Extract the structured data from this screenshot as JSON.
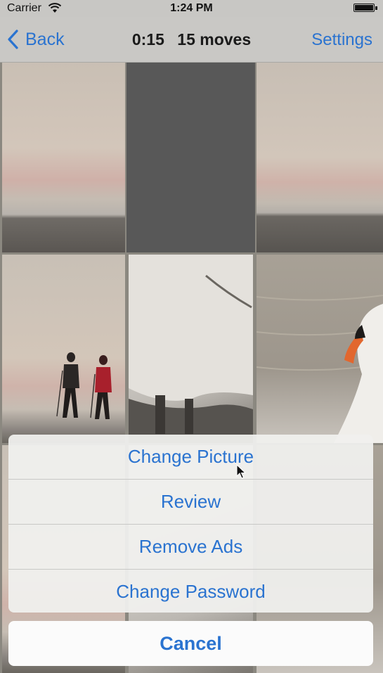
{
  "status_bar": {
    "carrier": "Carrier",
    "time": "1:24 PM",
    "wifi_icon": "wifi-icon",
    "battery_icon": "battery-icon",
    "battery_level": 1.0
  },
  "nav_bar": {
    "back_label": "Back",
    "timer": "0:15",
    "moves": "15 moves",
    "settings_label": "Settings"
  },
  "puzzle": {
    "rows": 3,
    "columns": 3,
    "empty_tile": {
      "row": 1,
      "column": 2
    },
    "image_description_tiles": [
      "beach-sky",
      "empty",
      "beach-sky",
      "beach-walkers",
      "swan-body",
      "swan-head",
      "",
      "",
      ""
    ]
  },
  "action_sheet": {
    "items": [
      {
        "label": "Change Picture"
      },
      {
        "label": "Review"
      },
      {
        "label": "Remove Ads"
      },
      {
        "label": "Change Password"
      }
    ],
    "cancel_label": "Cancel"
  },
  "colors": {
    "accent": "#2a73d0",
    "nav_background": "#c9c8c5",
    "empty_tile": "#585858"
  }
}
